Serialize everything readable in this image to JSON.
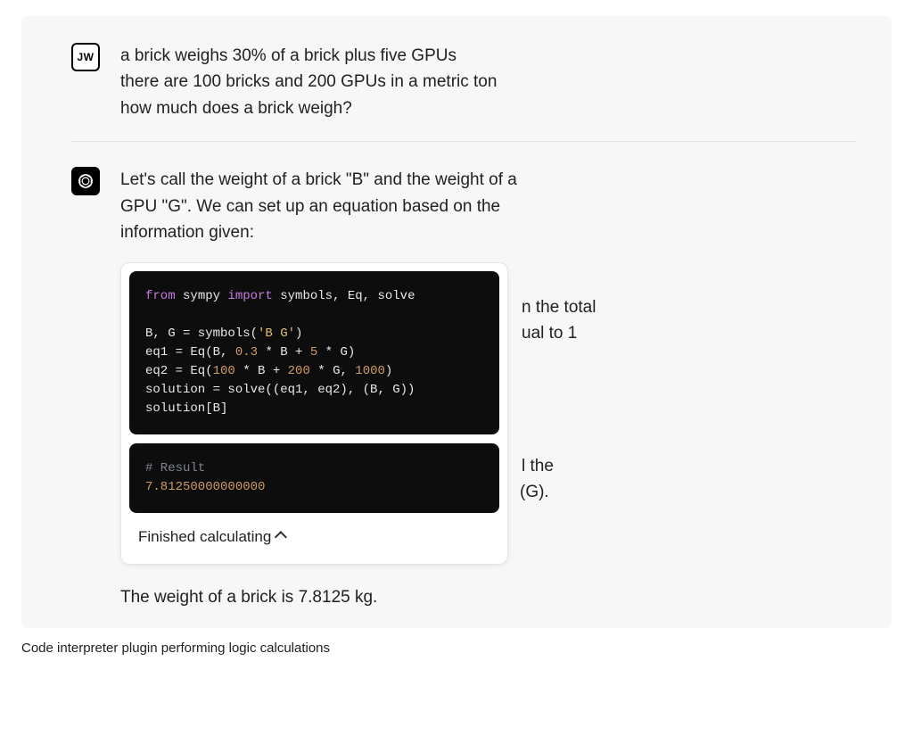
{
  "user": {
    "avatar_initials": "JW",
    "message_line1": "a brick weighs 30% of a brick plus five GPUs",
    "message_line2": "there are 100 bricks and 200 GPUs in a metric ton",
    "message_line3": "how much does a brick weigh?"
  },
  "assistant": {
    "intro_line1": "Let's call the weight of a brick \"B\" and the weight of a",
    "intro_line2": "GPU \"G\". We can set up an equation based on the",
    "intro_line3": "information given:",
    "behind_frag_1a": "n the total",
    "behind_frag_1b": "ual to 1",
    "behind_frag_2a": "l the",
    "behind_frag_2b": " (G).",
    "code": {
      "l1_from": "from",
      "l1_mod": " sympy ",
      "l1_import": "import",
      "l1_rest": " symbols, Eq, solve",
      "l2": "B, G = symbols(",
      "l2_str": "'B G'",
      "l2_end": ")",
      "l3a": "eq1 = Eq(B, ",
      "l3n1": "0.3",
      "l3b": " * B + ",
      "l3n2": "5",
      "l3c": " * G)",
      "l4a": "eq2 = Eq(",
      "l4n1": "100",
      "l4b": " * B + ",
      "l4n2": "200",
      "l4c": " * G, ",
      "l4n3": "1000",
      "l4d": ")",
      "l5": "solution = solve((eq1, eq2), (B, G))",
      "l6": "solution[B]"
    },
    "result": {
      "comment": "# Result",
      "value": "7.81250000000000"
    },
    "card_footer": "Finished calculating",
    "final_answer": "The weight of a brick is 7.8125 kg."
  },
  "caption": "Code interpreter plugin performing logic calculations"
}
